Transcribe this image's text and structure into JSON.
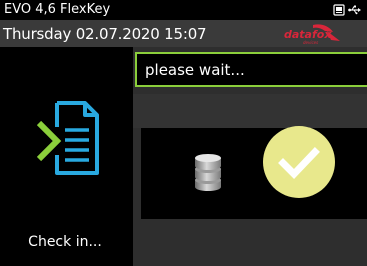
{
  "status_bar": {
    "device_name": "EVO 4,6 FlexKey",
    "icons": [
      "screen-icon",
      "usb-icon"
    ]
  },
  "header": {
    "datetime": "Thursday 02.07.2020 15:07",
    "logo_icon": "datafox-logo"
  },
  "left_panel": {
    "icon": "document-arrow-icon",
    "label": "Check in..."
  },
  "message": {
    "text": "please wait..."
  },
  "result": {
    "icons": [
      "database-icon",
      "checkmark-circle-icon"
    ]
  },
  "colors": {
    "background": "#000000",
    "header_bg": "#3a3a3a",
    "panel_bg": "#2e2e2e",
    "accent_green": "#8bcf3b",
    "doc_blue": "#29a9e0",
    "check_yellow": "#e8e88c",
    "logo_red": "#d9263a"
  }
}
